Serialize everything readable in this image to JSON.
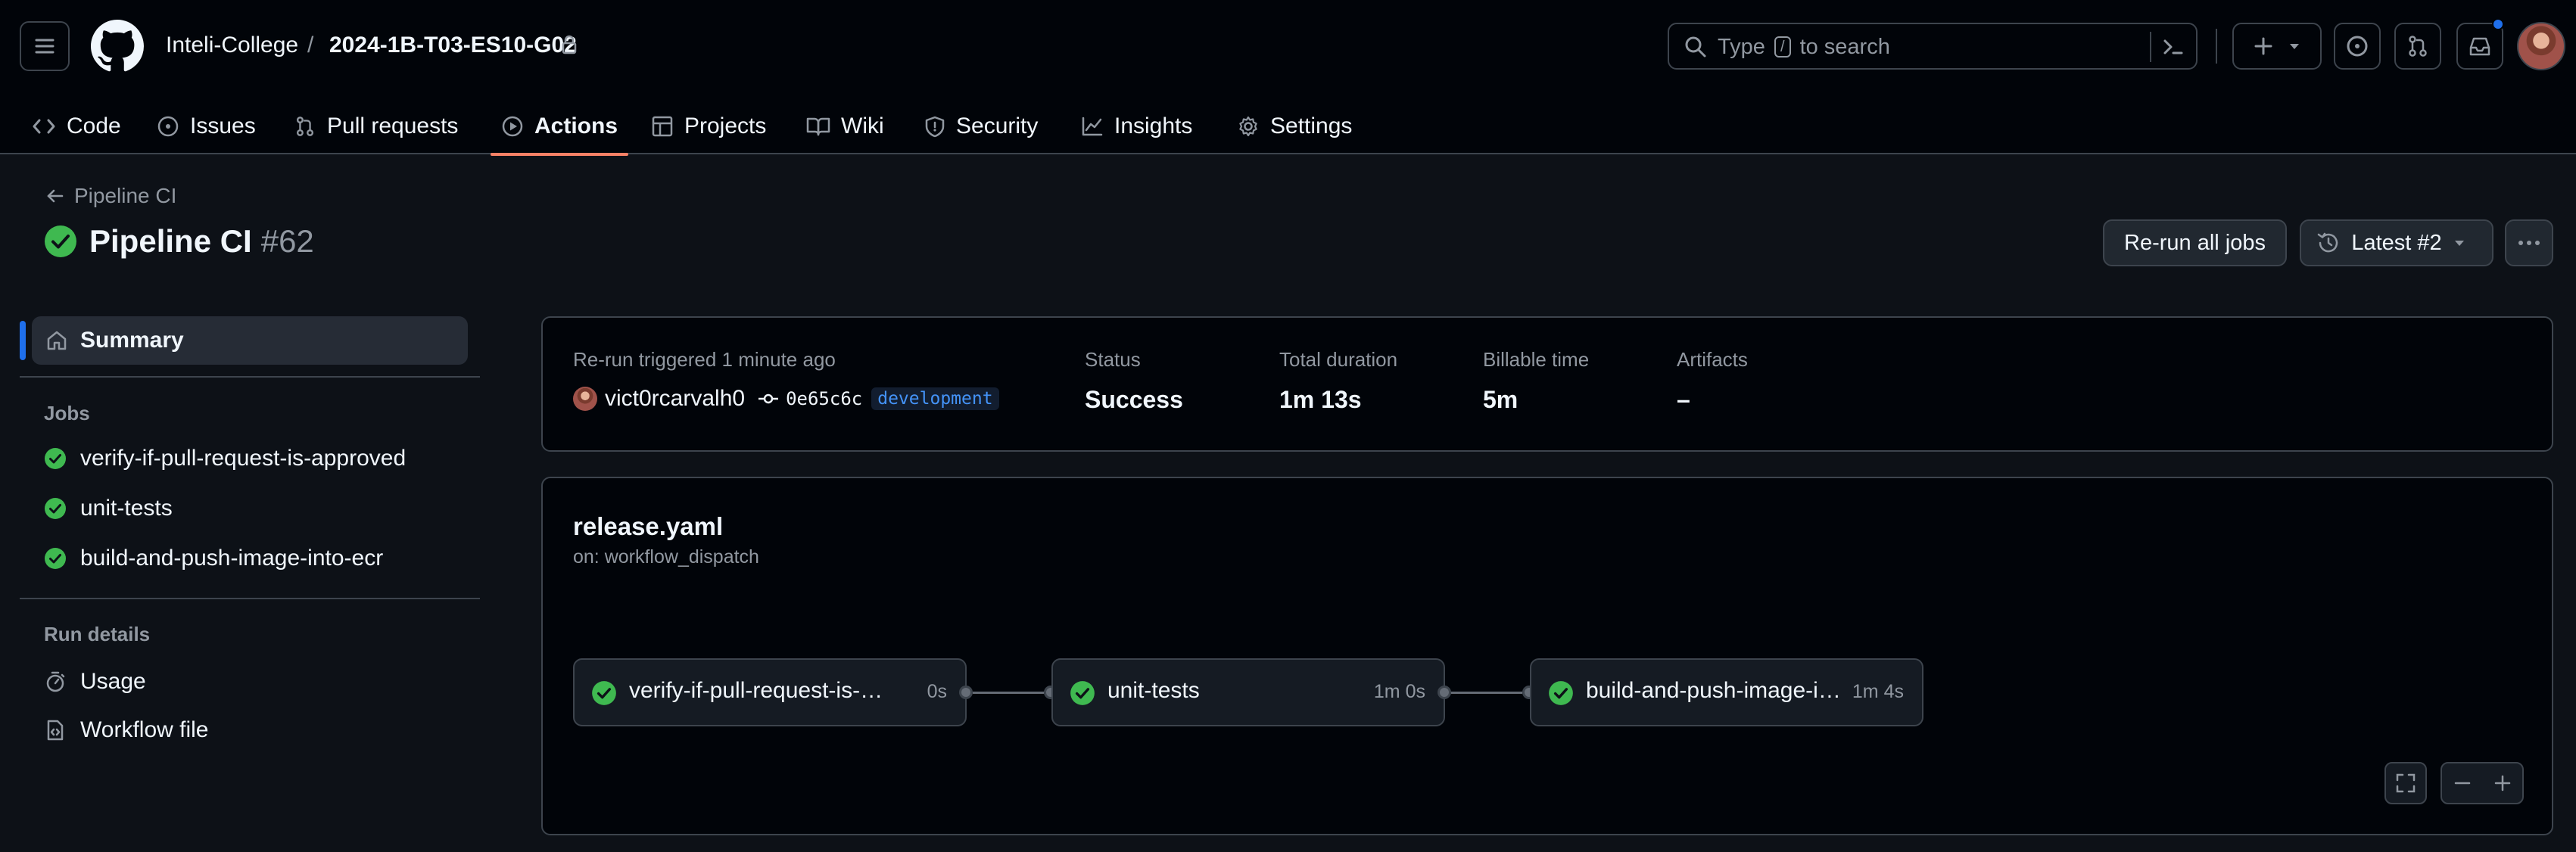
{
  "header": {
    "owner": "Inteli-College",
    "separator": "/",
    "repo": "2024-1B-T03-ES10-G02",
    "search": {
      "prefix": "Type",
      "key": "/",
      "suffix": "to search"
    }
  },
  "tabs": [
    {
      "label": "Code",
      "icon": "code-icon"
    },
    {
      "label": "Issues",
      "icon": "issue-icon"
    },
    {
      "label": "Pull requests",
      "icon": "pull-request-icon"
    },
    {
      "label": "Actions",
      "icon": "play-icon",
      "active": true
    },
    {
      "label": "Projects",
      "icon": "table-icon"
    },
    {
      "label": "Wiki",
      "icon": "book-icon"
    },
    {
      "label": "Security",
      "icon": "shield-icon"
    },
    {
      "label": "Insights",
      "icon": "graph-icon"
    },
    {
      "label": "Settings",
      "icon": "gear-icon"
    }
  ],
  "run": {
    "back_label": "Pipeline CI",
    "title": "Pipeline CI",
    "number": "#62",
    "rerun_label": "Re-run all jobs",
    "attempt_label": "Latest #2"
  },
  "sidebar": {
    "summary_label": "Summary",
    "jobs_heading": "Jobs",
    "jobs": [
      "verify-if-pull-request-is-approved",
      "unit-tests",
      "build-and-push-image-into-ecr"
    ],
    "run_details_heading": "Run details",
    "details": [
      "Usage",
      "Workflow file"
    ]
  },
  "summary": {
    "trigger_label": "Re-run triggered 1 minute ago",
    "actor": "vict0rcarvalh0",
    "commit": "0e65c6c",
    "branch": "development",
    "status_label": "Status",
    "status_value": "Success",
    "duration_label": "Total duration",
    "duration_value": "1m 13s",
    "billable_label": "Billable time",
    "billable_value": "5m",
    "artifacts_label": "Artifacts",
    "artifacts_value": "–"
  },
  "workflow": {
    "file": "release.yaml",
    "trigger": "on: workflow_dispatch",
    "jobs": [
      {
        "name": "verify-if-pull-request-is-approved",
        "time": "0s"
      },
      {
        "name": "unit-tests",
        "time": "1m 0s"
      },
      {
        "name": "build-and-push-image-into-ecr",
        "time": "1m 4s"
      }
    ]
  },
  "colors": {
    "success": "#3fb950",
    "accent_underline": "#f78166",
    "link_blue": "#4493f8"
  }
}
